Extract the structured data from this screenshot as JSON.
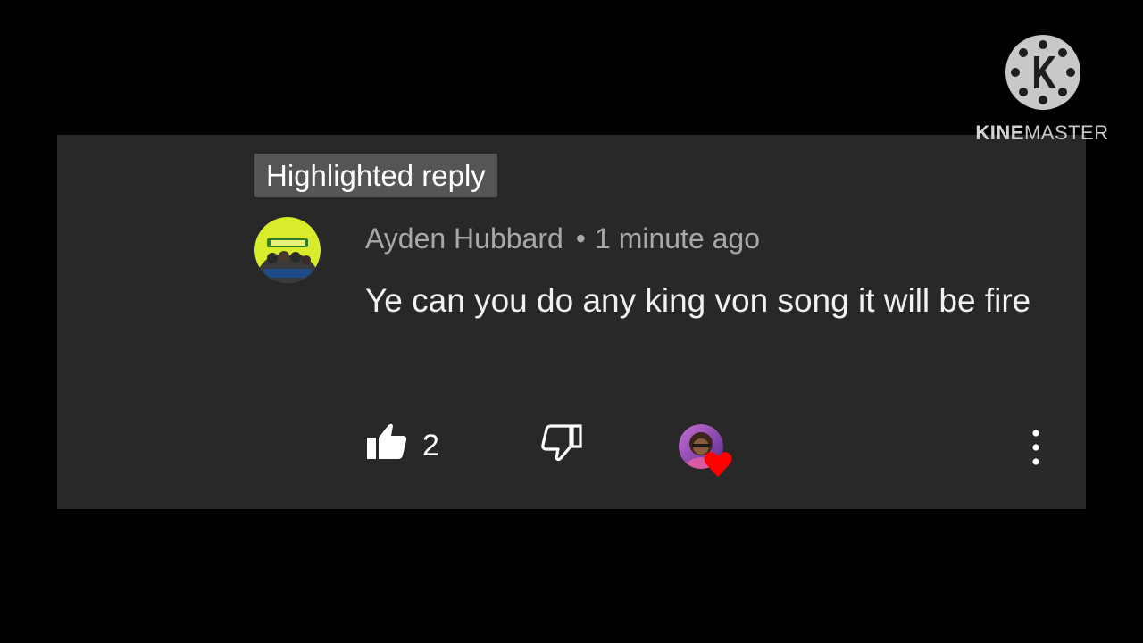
{
  "badge": {
    "label": "Highlighted reply"
  },
  "comment": {
    "author": "Ayden Hubbard",
    "separator": "•",
    "time": "1 minute ago",
    "text": "Ye can you do any king von song it will be fire",
    "like_count": "2",
    "hearted_by_creator": true
  },
  "watermark": {
    "brand_bold": "KINE",
    "brand_rest": "MASTER"
  },
  "icons": {
    "like": "thumbs-up-icon",
    "dislike": "thumbs-down-icon",
    "heart": "heart-icon",
    "more": "more-vert-icon",
    "watermark_logo": "kinemaster-logo-icon"
  },
  "colors": {
    "background": "#000000",
    "card": "#282828",
    "badge": "#555555",
    "meta_text": "#a8a8a8",
    "comment_text": "#f1f1f1",
    "heart": "#ff0000",
    "avatar_bg": "#d8ec2c"
  }
}
